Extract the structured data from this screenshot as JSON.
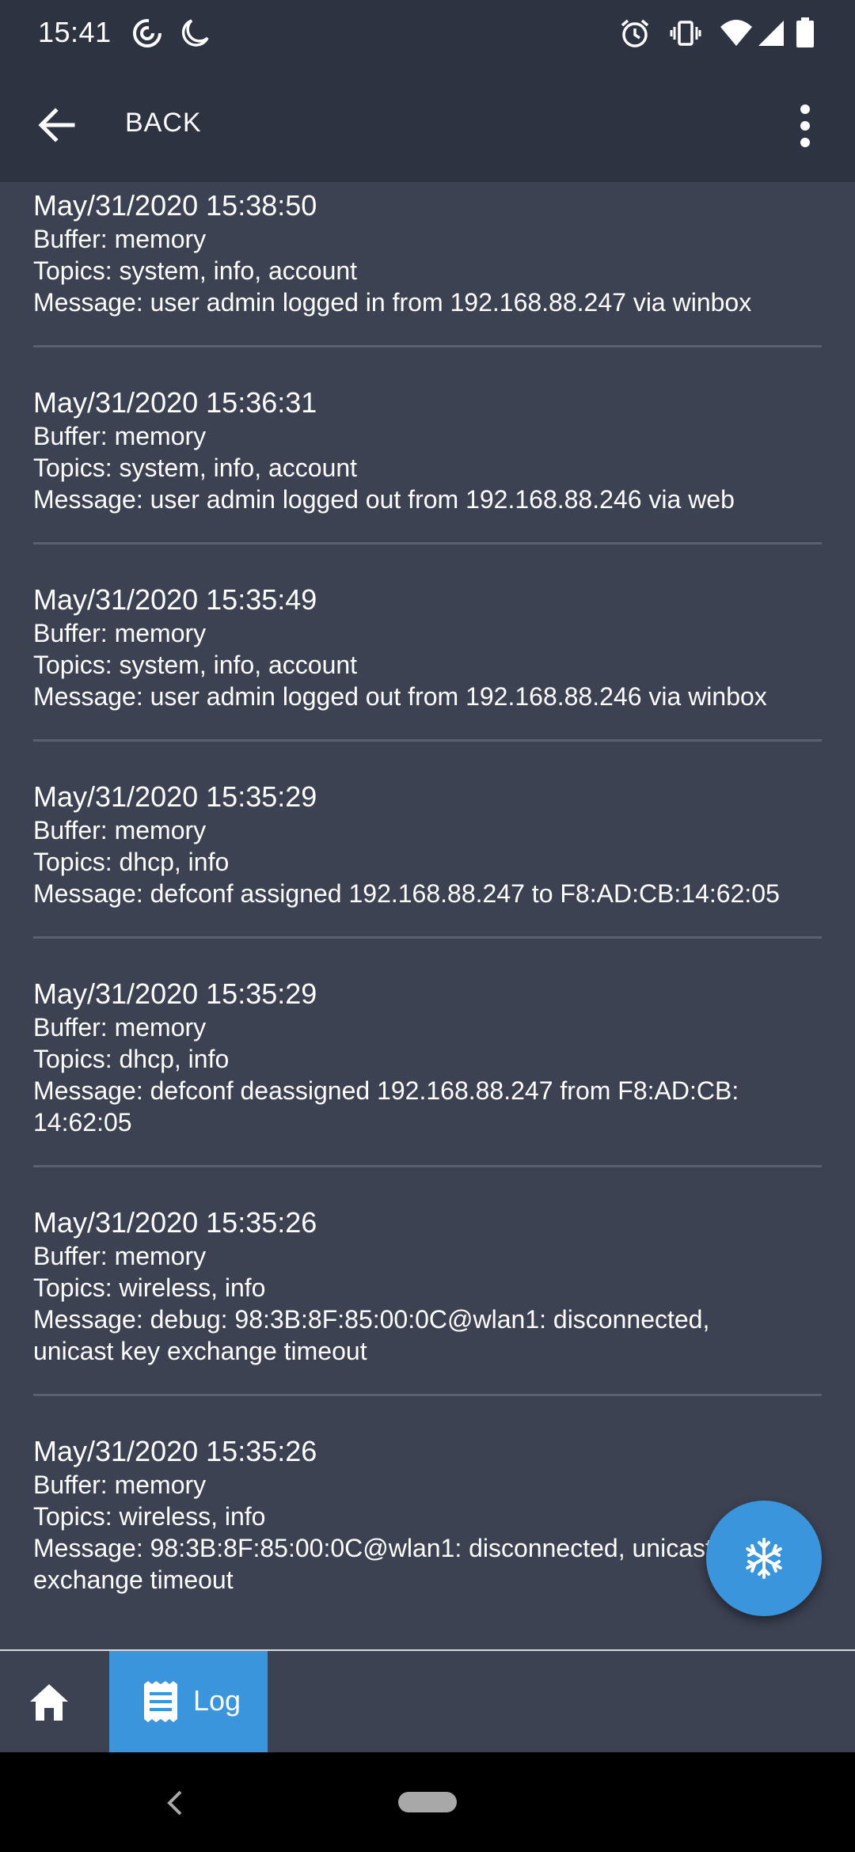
{
  "status_bar": {
    "time": "15:41",
    "left_icons": [
      "hotspot-icon",
      "do-not-disturb-icon"
    ],
    "right_icons": [
      "alarm-icon",
      "vibrate-icon",
      "wifi-icon",
      "signal-icon",
      "battery-icon"
    ]
  },
  "app_bar": {
    "title": "BACK"
  },
  "log": {
    "entries": [
      {
        "time": "May/31/2020 15:38:50",
        "buffer": "Buffer: memory",
        "topics": "Topics: system, info, account",
        "message": "Message: user admin logged in from 192.168.88.247 via winbox"
      },
      {
        "time": "May/31/2020 15:36:31",
        "buffer": "Buffer: memory",
        "topics": "Topics: system, info, account",
        "message": "Message: user admin logged out from 192.168.88.246 via web"
      },
      {
        "time": "May/31/2020 15:35:49",
        "buffer": "Buffer: memory",
        "topics": "Topics: system, info, account",
        "message": "Message: user admin logged out from 192.168.88.246 via winbox"
      },
      {
        "time": "May/31/2020 15:35:29",
        "buffer": "Buffer: memory",
        "topics": "Topics: dhcp, info",
        "message": "Message: defconf assigned 192.168.88.247 to F8:AD:CB:14:62:05"
      },
      {
        "time": "May/31/2020 15:35:29",
        "buffer": "Buffer: memory",
        "topics": "Topics: dhcp, info",
        "message": "Message: defconf deassigned 192.168.88.247 from F8:AD:CB:\n14:62:05"
      },
      {
        "time": "May/31/2020 15:35:26",
        "buffer": "Buffer: memory",
        "topics": "Topics: wireless, info",
        "message": "Message: debug: 98:3B:8F:85:00:0C@wlan1: disconnected,\nunicast key exchange timeout"
      },
      {
        "time": "May/31/2020 15:35:26",
        "buffer": "Buffer: memory",
        "topics": "Topics: wireless, info",
        "message": "Message: 98:3B:8F:85:00:0C@wlan1: disconnected, unicast key\nexchange timeout"
      }
    ]
  },
  "fab": {
    "icon": "snowflake-icon"
  },
  "bottom_nav": {
    "home_icon": "home-icon",
    "log_icon": "log-document-icon",
    "log_label": "Log"
  },
  "colors": {
    "background": "#3d4253",
    "app_bar": "#2e3342",
    "accent": "#3b95dc",
    "divider": "#586072"
  }
}
